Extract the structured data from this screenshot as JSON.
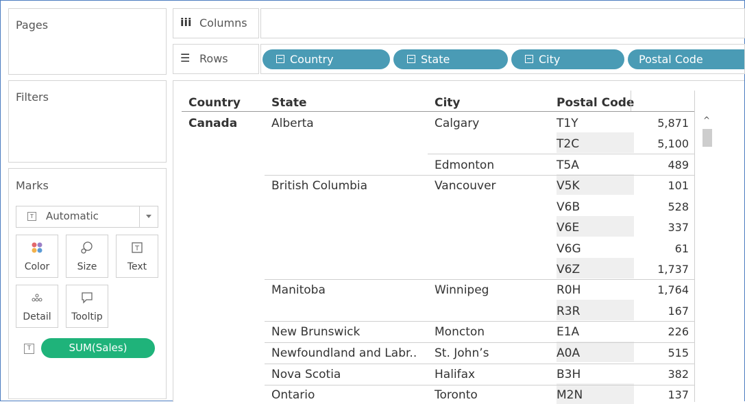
{
  "cards": {
    "pages": "Pages",
    "filters": "Filters",
    "marks": "Marks"
  },
  "marks": {
    "mark_type": "Automatic",
    "buttons": {
      "color": "Color",
      "size": "Size",
      "text": "Text",
      "detail": "Detail",
      "tooltip": "Tooltip"
    },
    "measure_pill": "SUM(Sales)"
  },
  "shelves": {
    "columns_label": "Columns",
    "rows_label": "Rows",
    "row_pills": [
      "Country",
      "State",
      "City",
      "Postal Code"
    ]
  },
  "table": {
    "headers": [
      "Country",
      "State",
      "City",
      "Postal Code"
    ],
    "country": "Canada",
    "states": [
      "Alberta",
      "British Columbia",
      "Manitoba",
      "New Brunswick",
      "Newfoundland and Labr..",
      "Nova Scotia",
      "Ontario"
    ],
    "cities": [
      "Calgary",
      "Edmonton",
      "Vancouver",
      "Winnipeg",
      "Moncton",
      "St. John’s",
      "Halifax",
      "Toronto"
    ],
    "postal_codes": [
      "T1Y",
      "T2C",
      "T5A",
      "V5K",
      "V6B",
      "V6E",
      "V6G",
      "V6Z",
      "R0H",
      "R3R",
      "E1A",
      "A0A",
      "B3H",
      "M2N"
    ],
    "values": [
      "5,871",
      "5,100",
      "489",
      "101",
      "528",
      "337",
      "61",
      "1,737",
      "1,764",
      "167",
      "226",
      "515",
      "382",
      "137"
    ]
  },
  "colors": {
    "pill_blue": "#4a9bb5",
    "pill_green": "#1fb37a",
    "frame": "#4a7bbf"
  },
  "icons": {
    "columns": "columns-icon",
    "rows": "rows-icon",
    "scroll_up": "chevron-up-icon"
  }
}
